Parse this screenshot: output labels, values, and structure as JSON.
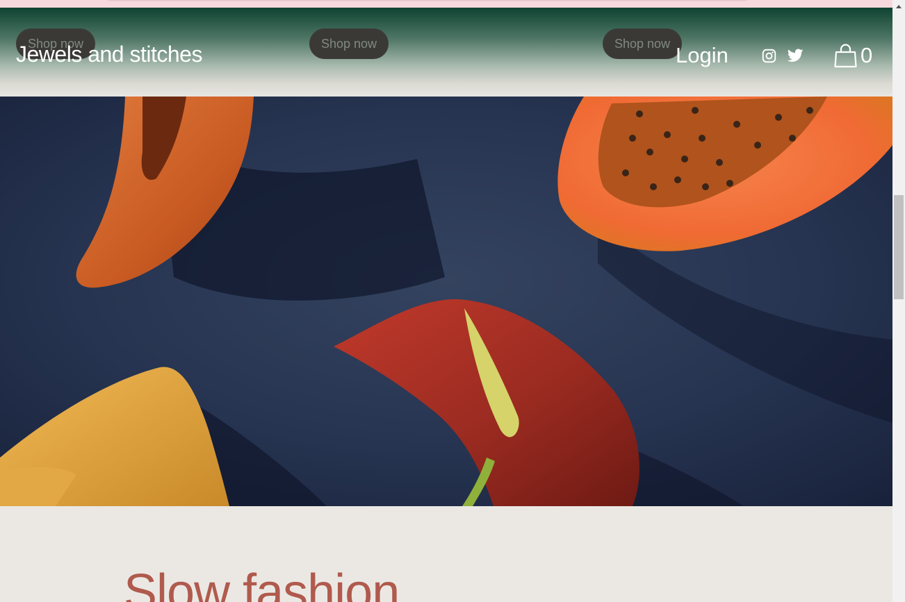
{
  "header": {
    "brand": "Jewels and stitches",
    "login_label": "Login",
    "cart_count": "0",
    "icons": [
      "instagram-icon",
      "twitter-icon",
      "shopping-bag-icon"
    ],
    "shop_buttons": [
      "Shop now",
      "Shop now",
      "Shop now"
    ]
  },
  "hero": {
    "image": "flat-lay-still-life"
  },
  "section": {
    "title": "Slow fashion"
  },
  "colors": {
    "header_gradient_top": "#0f4331",
    "page_background": "#ebe8e4",
    "title_accent": "#b05a4d",
    "button_bg": "#3b3936",
    "hero_fabric": "#1f2a44"
  }
}
